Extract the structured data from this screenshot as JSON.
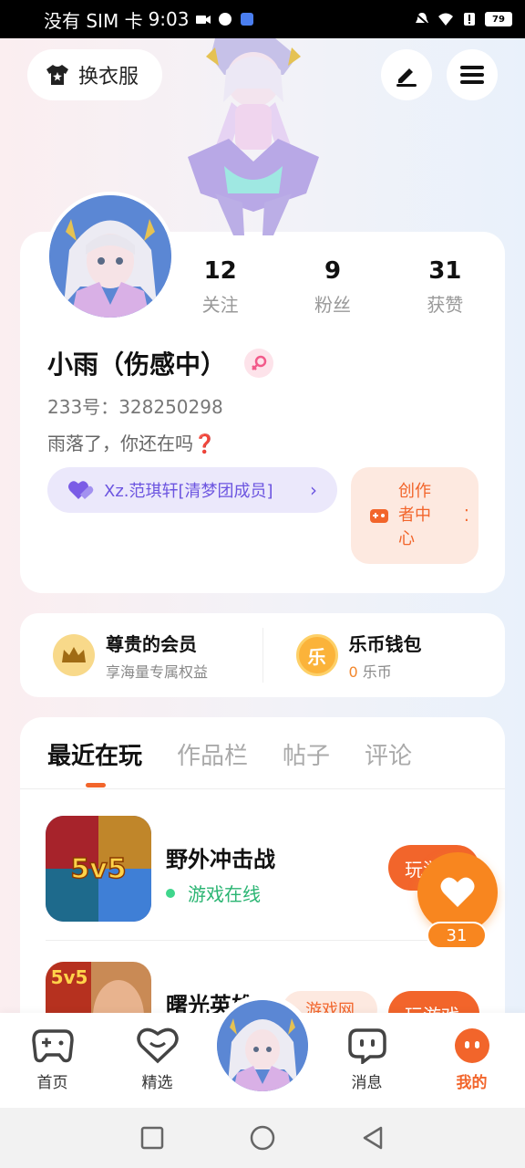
{
  "statusbar": {
    "carrier": "没有 SIM 卡",
    "time": "9:03",
    "battery": "79"
  },
  "header": {
    "dress_label": "换衣服"
  },
  "profile": {
    "stats": [
      {
        "value": "12",
        "label": "关注"
      },
      {
        "value": "9",
        "label": "粉丝"
      },
      {
        "value": "31",
        "label": "获赞"
      }
    ],
    "name": "小雨（伤感中）",
    "uid_label": "233号：",
    "uid": "328250298",
    "bio": "雨落了，你还在吗❓",
    "team": "Xz.范琪轩[清梦团成员]",
    "creator_label": "创作者中心"
  },
  "member": {
    "vip_title": "尊贵的会员",
    "vip_sub": "享海量专属权益",
    "vip_badge": "乐",
    "wallet_title": "乐币钱包",
    "wallet_value": "0",
    "wallet_unit": "乐币"
  },
  "tabs": [
    "最近在玩",
    "作品栏",
    "帖子",
    "评论"
  ],
  "games": [
    {
      "name": "野外冲击战",
      "status": "游戏在线",
      "action": "玩游",
      "icon_text": "5v5"
    },
    {
      "name": "曙光英雄",
      "status": "",
      "action": "玩游戏",
      "icon_text": "5v5",
      "tag": "游戏网"
    }
  ],
  "like_count": "31",
  "nav": [
    {
      "label": "首页",
      "icon": "gamepad-icon"
    },
    {
      "label": "精选",
      "icon": "heart-chat-icon"
    },
    {
      "label": "消息",
      "icon": "message-icon"
    },
    {
      "label": "我的",
      "icon": "me-icon"
    }
  ],
  "colors": {
    "accent": "#f2652b",
    "purple": "#6c55e0",
    "online": "#2bb573"
  }
}
